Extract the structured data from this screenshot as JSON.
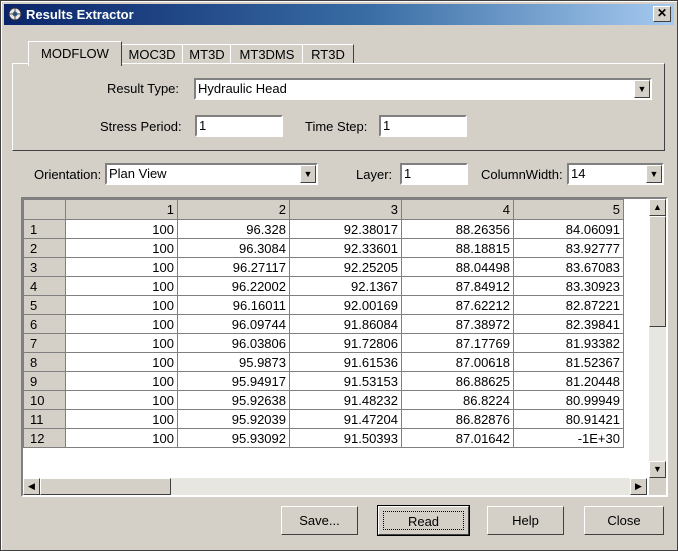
{
  "window": {
    "title": "Results Extractor",
    "close_glyph": "✕"
  },
  "tabs": [
    {
      "label": "MODFLOW",
      "active": true
    },
    {
      "label": "MOC3D",
      "active": false
    },
    {
      "label": "MT3D",
      "active": false
    },
    {
      "label": "MT3DMS",
      "active": false
    },
    {
      "label": "RT3D",
      "active": false
    }
  ],
  "form": {
    "result_type_label": "Result Type:",
    "result_type_value": "Hydraulic Head",
    "stress_period_label": "Stress Period:",
    "stress_period_value": "1",
    "time_step_label": "Time Step:",
    "time_step_value": "1"
  },
  "options": {
    "orientation_label": "Orientation:",
    "orientation_value": "Plan View",
    "layer_label": "Layer:",
    "layer_value": "1",
    "column_width_label": "ColumnWidth:",
    "column_width_value": "14"
  },
  "grid": {
    "columns": [
      "1",
      "2",
      "3",
      "4",
      "5"
    ],
    "rows": [
      {
        "id": "1",
        "cells": [
          "100",
          "96.328",
          "92.38017",
          "88.26356",
          "84.06091"
        ]
      },
      {
        "id": "2",
        "cells": [
          "100",
          "96.3084",
          "92.33601",
          "88.18815",
          "83.92777"
        ]
      },
      {
        "id": "3",
        "cells": [
          "100",
          "96.27117",
          "92.25205",
          "88.04498",
          "83.67083"
        ]
      },
      {
        "id": "4",
        "cells": [
          "100",
          "96.22002",
          "92.1367",
          "87.84912",
          "83.30923"
        ]
      },
      {
        "id": "5",
        "cells": [
          "100",
          "96.16011",
          "92.00169",
          "87.62212",
          "82.87221"
        ]
      },
      {
        "id": "6",
        "cells": [
          "100",
          "96.09744",
          "91.86084",
          "87.38972",
          "82.39841"
        ]
      },
      {
        "id": "7",
        "cells": [
          "100",
          "96.03806",
          "91.72806",
          "87.17769",
          "81.93382"
        ]
      },
      {
        "id": "8",
        "cells": [
          "100",
          "95.9873",
          "91.61536",
          "87.00618",
          "81.52367"
        ]
      },
      {
        "id": "9",
        "cells": [
          "100",
          "95.94917",
          "91.53153",
          "86.88625",
          "81.20448"
        ]
      },
      {
        "id": "10",
        "cells": [
          "100",
          "95.92638",
          "91.48232",
          "86.8224",
          "80.99949"
        ]
      },
      {
        "id": "11",
        "cells": [
          "100",
          "95.92039",
          "91.47204",
          "86.82876",
          "80.91421"
        ]
      },
      {
        "id": "12",
        "cells": [
          "100",
          "95.93092",
          "91.50393",
          "87.01642",
          "-1E+30"
        ]
      }
    ]
  },
  "buttons": {
    "save": "Save...",
    "read": "Read",
    "help": "Help",
    "close": "Close"
  },
  "icons": {
    "app": "gear-globe-icon",
    "dropdown": "▼",
    "up": "▲",
    "down": "▼",
    "left": "◀",
    "right": "▶"
  },
  "colors": {
    "title_start": "#0a246a",
    "title_end": "#a6caf0",
    "face": "#d4d0c8"
  }
}
